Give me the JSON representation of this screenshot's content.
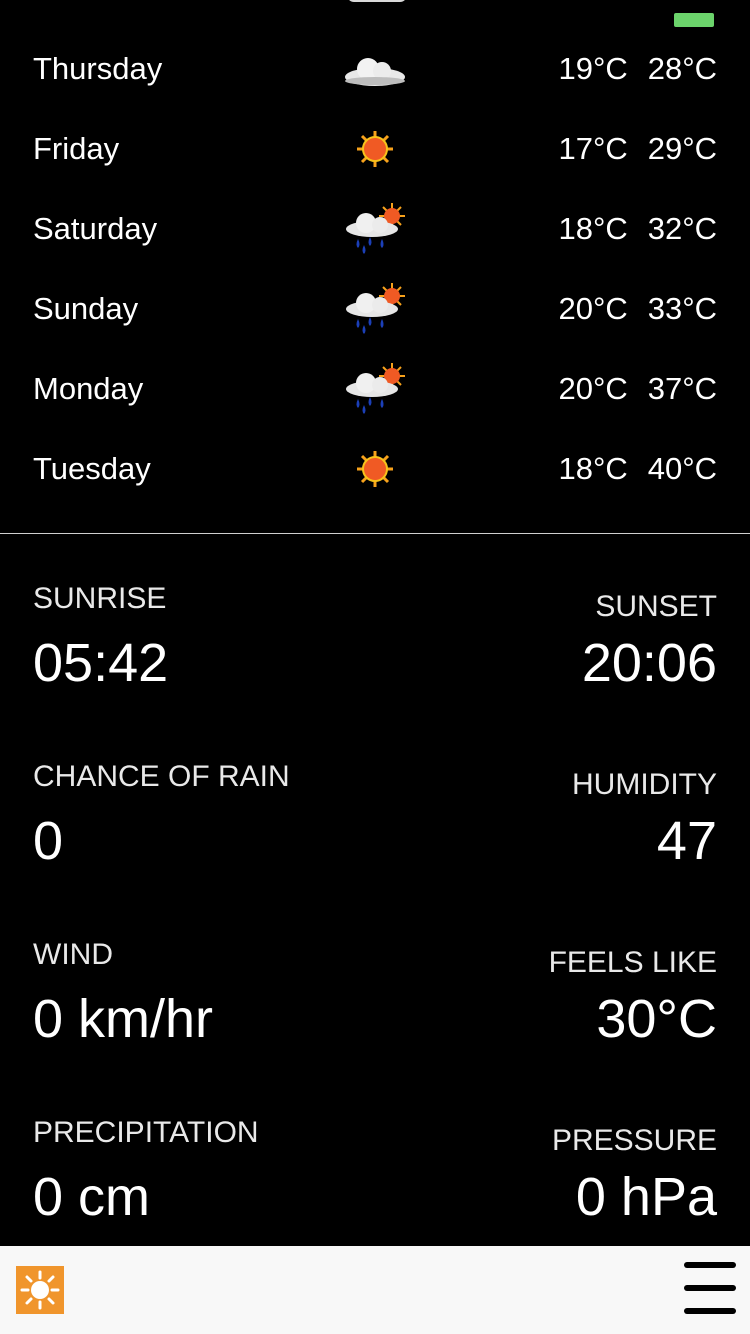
{
  "colors": {
    "background": "#000000",
    "text": "#ffffff",
    "label": "#e9e9e9",
    "divider": "#d0d0d0",
    "bottom_bar": "#f8f8f8",
    "logo": "#f0952c",
    "battery": "#6bd36b"
  },
  "forecast": [
    {
      "day": "Thursday",
      "icon": "cloudy-icon",
      "low": "19°C",
      "high": "28°C"
    },
    {
      "day": "Friday",
      "icon": "sunny-icon",
      "low": "17°C",
      "high": "29°C"
    },
    {
      "day": "Saturday",
      "icon": "rain-sun-icon",
      "low": "18°C",
      "high": "32°C"
    },
    {
      "day": "Sunday",
      "icon": "rain-sun-icon",
      "low": "20°C",
      "high": "33°C"
    },
    {
      "day": "Monday",
      "icon": "rain-sun-icon",
      "low": "20°C",
      "high": "37°C"
    },
    {
      "day": "Tuesday",
      "icon": "sunny-icon",
      "low": "18°C",
      "high": "40°C"
    }
  ],
  "details": {
    "sunrise_label": "SUNRISE",
    "sunrise_value": "05:42",
    "sunset_label": "SUNSET",
    "sunset_value": "20:06",
    "rain_label": "CHANCE OF RAIN",
    "rain_value": "0",
    "humidity_label": "HUMIDITY",
    "humidity_value": "47",
    "wind_label": "WIND",
    "wind_value": "0 km/hr",
    "feels_label": "FEELS LIKE",
    "feels_value": "30°C",
    "precip_label": "PRECIPITATION",
    "precip_value": "0 cm",
    "pressure_label": "PRESSURE",
    "pressure_value": "0 hPa"
  },
  "bottom_bar": {
    "logo_icon": "sun-logo-icon",
    "menu_icon": "hamburger-menu-icon"
  }
}
